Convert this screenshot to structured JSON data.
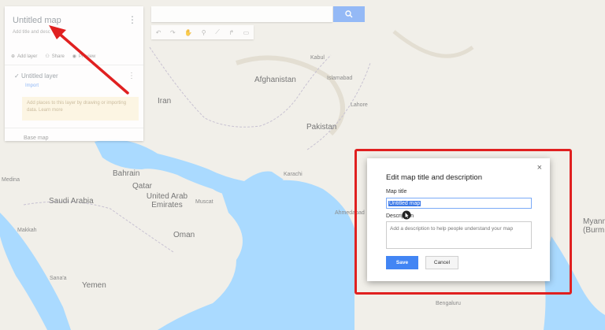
{
  "map": {
    "countries": [
      "Afghanistan",
      "Iran",
      "Pakistan",
      "Bahrain",
      "Qatar",
      "Saudi Arabia",
      "United Arab Emirates",
      "Oman",
      "Yemen",
      "Myanm (Burm"
    ],
    "cities": [
      "Kabul",
      "Islamabad",
      "Lahore",
      "Karachi",
      "Medina",
      "Makkah",
      "Muscat",
      "Sana'a",
      "Ahmedabad",
      "Bengaluru"
    ]
  },
  "panel": {
    "title": "Untitled map",
    "subtitle": "Add title and desc",
    "actions": {
      "add_layer": "Add layer",
      "share": "Share",
      "preview": "Preview"
    },
    "layer": {
      "name": "Untitled layer",
      "import": "Import"
    },
    "hint": "Add places to this layer by drawing or importing data. Learn more",
    "base_map": "Base map"
  },
  "toolbar": {
    "icons": [
      "undo-icon",
      "redo-icon",
      "hand-icon",
      "marker-icon",
      "line-icon",
      "route-icon",
      "ruler-icon"
    ]
  },
  "dialog": {
    "title": "Edit map title and description",
    "close": "×",
    "map_title_label": "Map title",
    "map_title_value": "Untitled map",
    "description_label": "Description",
    "description_placeholder": "Add a description to help people understand your map",
    "save": "Save",
    "cancel": "Cancel"
  },
  "colors": {
    "highlight": "#e02020",
    "accent": "#4285f4",
    "arrow": "#e02020"
  }
}
